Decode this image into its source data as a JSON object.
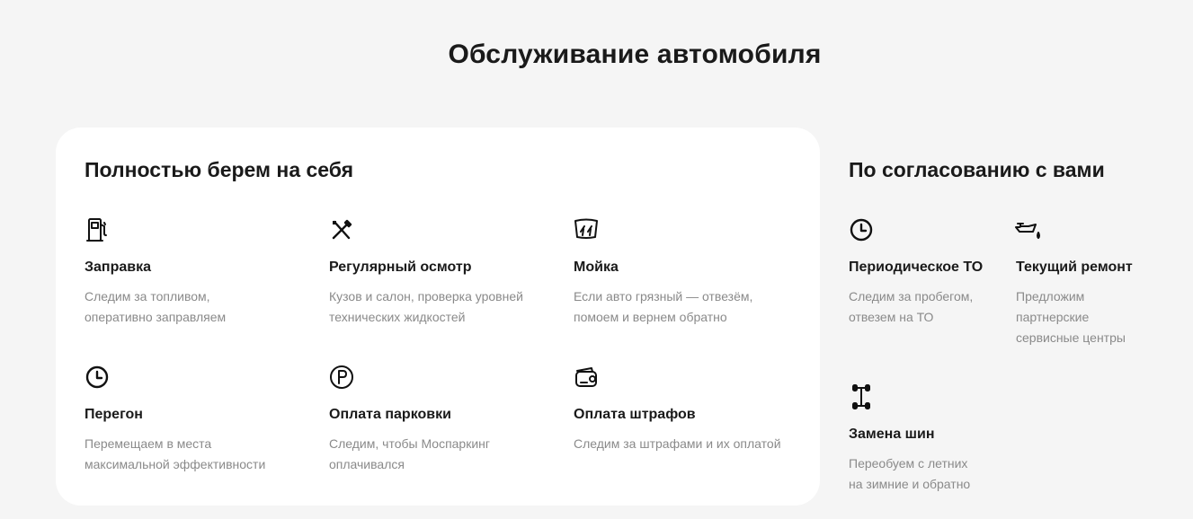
{
  "page": {
    "title": "Обслуживание автомобиля"
  },
  "full_service": {
    "title": "Полностью берем на себя",
    "items": [
      {
        "icon": "fuel-pump-icon",
        "name": "Заправка",
        "desc_line1": "Следим за топливом,",
        "desc_line2": "оперативно заправляем"
      },
      {
        "icon": "tools-icon",
        "name": "Регулярный осмотр",
        "desc_line1": "Кузов и салон, проверка уровней",
        "desc_line2": "технических жидкостей"
      },
      {
        "icon": "car-wash-icon",
        "name": "Мойка",
        "desc_line1": "Если авто грязный — отвезём,",
        "desc_line2": "помоем и вернем обратно"
      },
      {
        "icon": "clock-icon",
        "name": "Перегон",
        "desc_line1": "Перемещаем в места",
        "desc_line2": "максимальной эффективности"
      },
      {
        "icon": "parking-icon",
        "name": "Оплата парковки",
        "desc_line1": "Следим, чтобы Моспаркинг",
        "desc_line2": "оплачивался"
      },
      {
        "icon": "wallet-icon",
        "name": "Оплата штрафов",
        "desc_line1": "Следим за штрафами и их оплатой",
        "desc_line2": ""
      }
    ]
  },
  "by_agreement": {
    "title": "По согласованию с вами",
    "items": [
      {
        "icon": "clock-icon",
        "name": "Периодическое ТО",
        "desc_line1": "Следим за пробегом,",
        "desc_line2": "отвезем на ТО",
        "desc_line3": ""
      },
      {
        "icon": "oil-can-icon",
        "name": "Текущий ремонт",
        "desc_line1": "Предложим",
        "desc_line2": "партнерские",
        "desc_line3": "сервисные центры"
      },
      {
        "icon": "tire-change-icon",
        "name": "Замена шин",
        "desc_line1": "Переобуем с летних",
        "desc_line2": "на зимние и обратно",
        "desc_line3": ""
      }
    ]
  }
}
